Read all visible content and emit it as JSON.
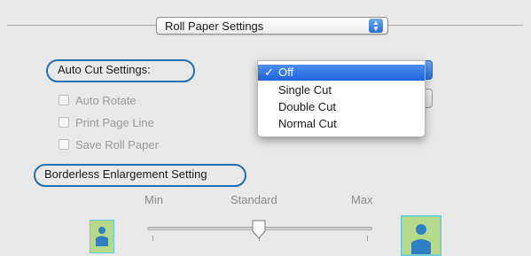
{
  "settings_popup": {
    "label": "Roll Paper Settings"
  },
  "auto_cut": {
    "label": "Auto Cut Settings:",
    "menu_items": [
      {
        "label": "Off",
        "checked": true
      },
      {
        "label": "Single Cut",
        "checked": false
      },
      {
        "label": "Double Cut",
        "checked": false
      },
      {
        "label": "Normal Cut",
        "checked": false
      }
    ],
    "checkmark": "✓"
  },
  "options": [
    {
      "label": "Auto Rotate",
      "checked": false,
      "enabled": false
    },
    {
      "label": "Print Page Line",
      "checked": false,
      "enabled": false
    },
    {
      "label": "Save Roll Paper",
      "checked": false,
      "enabled": false
    }
  ],
  "borderless": {
    "label": "Borderless Enlargement Setting",
    "slider": {
      "min_label": "Min",
      "standard_label": "Standard",
      "max_label": "Max",
      "value_level": "Standard"
    }
  },
  "colors": {
    "highlight_oval": "#1f6fb3",
    "selection_blue": "#2a6fd6",
    "icon_frame": "#62c9e8",
    "icon_fill": "#b6d98a"
  },
  "icons": [
    "small-image-icon",
    "large-image-icon",
    "popup-arrows-icon",
    "checkmark-icon",
    "slider-knob-icon"
  ]
}
